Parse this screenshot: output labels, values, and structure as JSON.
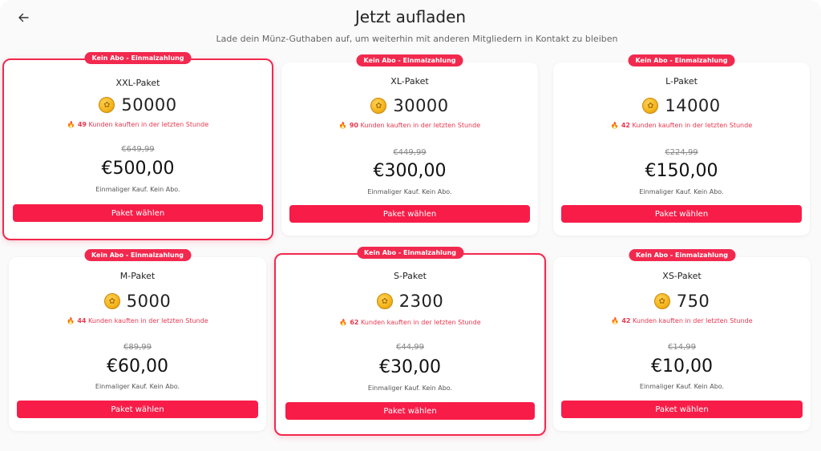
{
  "header": {
    "title": "Jetzt aufladen",
    "subtitle": "Lade dein Münz-Guthaben auf, um weiterhin mit anderen Mitgliedern in Kontakt zu bleiben"
  },
  "colors": {
    "accent": "#f2294e",
    "button": "#f71d48",
    "buyers_text": "#e8374f"
  },
  "packages": [
    {
      "badge": "Kein Abo - Einmalzahlung",
      "name": "XXL-Paket",
      "coins": "50000",
      "buyers_count": "49",
      "buyers_text": "Kunden kauften in der letzten Stunde",
      "old_price": "€649,99",
      "price": "€500,00",
      "note": "Einmaliger Kauf. Kein Abo.",
      "button": "Paket wählen",
      "highlighted": true
    },
    {
      "badge": "Kein Abo - Einmalzahlung",
      "name": "XL-Paket",
      "coins": "30000",
      "buyers_count": "90",
      "buyers_text": "Kunden kauften in der letzten Stunde",
      "old_price": "€449,99",
      "price": "€300,00",
      "note": "Einmaliger Kauf. Kein Abo.",
      "button": "Paket wählen",
      "highlighted": false
    },
    {
      "badge": "Kein Abo - Einmalzahlung",
      "name": "L-Paket",
      "coins": "14000",
      "buyers_count": "42",
      "buyers_text": "Kunden kauften in der letzten Stunde",
      "old_price": "€224,99",
      "price": "€150,00",
      "note": "Einmaliger Kauf. Kein Abo.",
      "button": "Paket wählen",
      "highlighted": false
    },
    {
      "badge": "Kein Abo - Einmalzahlung",
      "name": "M-Paket",
      "coins": "5000",
      "buyers_count": "44",
      "buyers_text": "Kunden kauften in der letzten Stunde",
      "old_price": "€89,99",
      "price": "€60,00",
      "note": "Einmaliger Kauf. Kein Abo.",
      "button": "Paket wählen",
      "highlighted": false
    },
    {
      "badge": "Kein Abo - Einmalzahlung",
      "name": "S-Paket",
      "coins": "2300",
      "buyers_count": "62",
      "buyers_text": "Kunden kauften in der letzten Stunde",
      "old_price": "€44,99",
      "price": "€30,00",
      "note": "Einmaliger Kauf. Kein Abo.",
      "button": "Paket wählen",
      "highlighted": true
    },
    {
      "badge": "Kein Abo - Einmalzahlung",
      "name": "XS-Paket",
      "coins": "750",
      "buyers_count": "42",
      "buyers_text": "Kunden kauften in der letzten Stunde",
      "old_price": "€14,99",
      "price": "€10,00",
      "note": "Einmaliger Kauf. Kein Abo.",
      "button": "Paket wählen",
      "highlighted": false
    }
  ]
}
